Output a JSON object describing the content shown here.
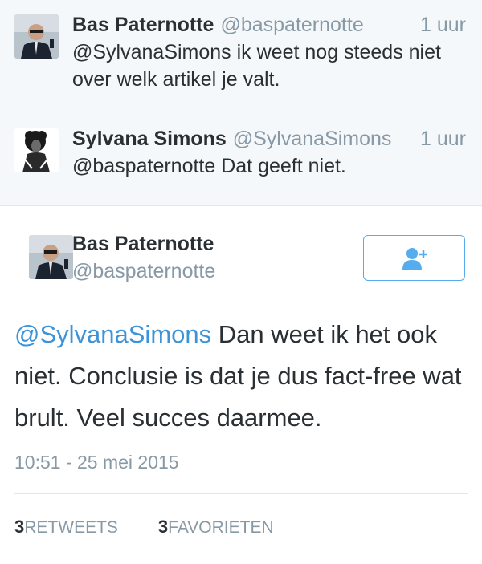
{
  "thread": [
    {
      "name": "Bas Paternotte",
      "handle": "@baspaternotte",
      "time": "1 uur",
      "text": "@SylvanaSimons ik weet nog steeds niet over welk artikel je valt."
    },
    {
      "name": "Sylvana Simons",
      "handle": "@SylvanaSimons",
      "time": "1 uur",
      "text": "@baspaternotte Dat geeft niet."
    }
  ],
  "main_tweet": {
    "name": "Bas Paternotte",
    "handle": "@baspaternotte",
    "mention": "@SylvanaSimons",
    "text": " Dan weet ik het ook niet. Conclusie is dat je dus fact-free wat brult. Veel succes daarmee.",
    "timestamp": "10:51 - 25 mei 2015",
    "follow_icon": "follow-user-icon",
    "retweets_count": "3",
    "retweets_label": "RETWEETS",
    "favorites_count": "3",
    "favorites_label": "FAVORIETEN"
  },
  "colors": {
    "link": "#3b94d9",
    "muted": "#8899a6",
    "thread_bg": "#f5f8fa",
    "accent": "#55acee"
  }
}
